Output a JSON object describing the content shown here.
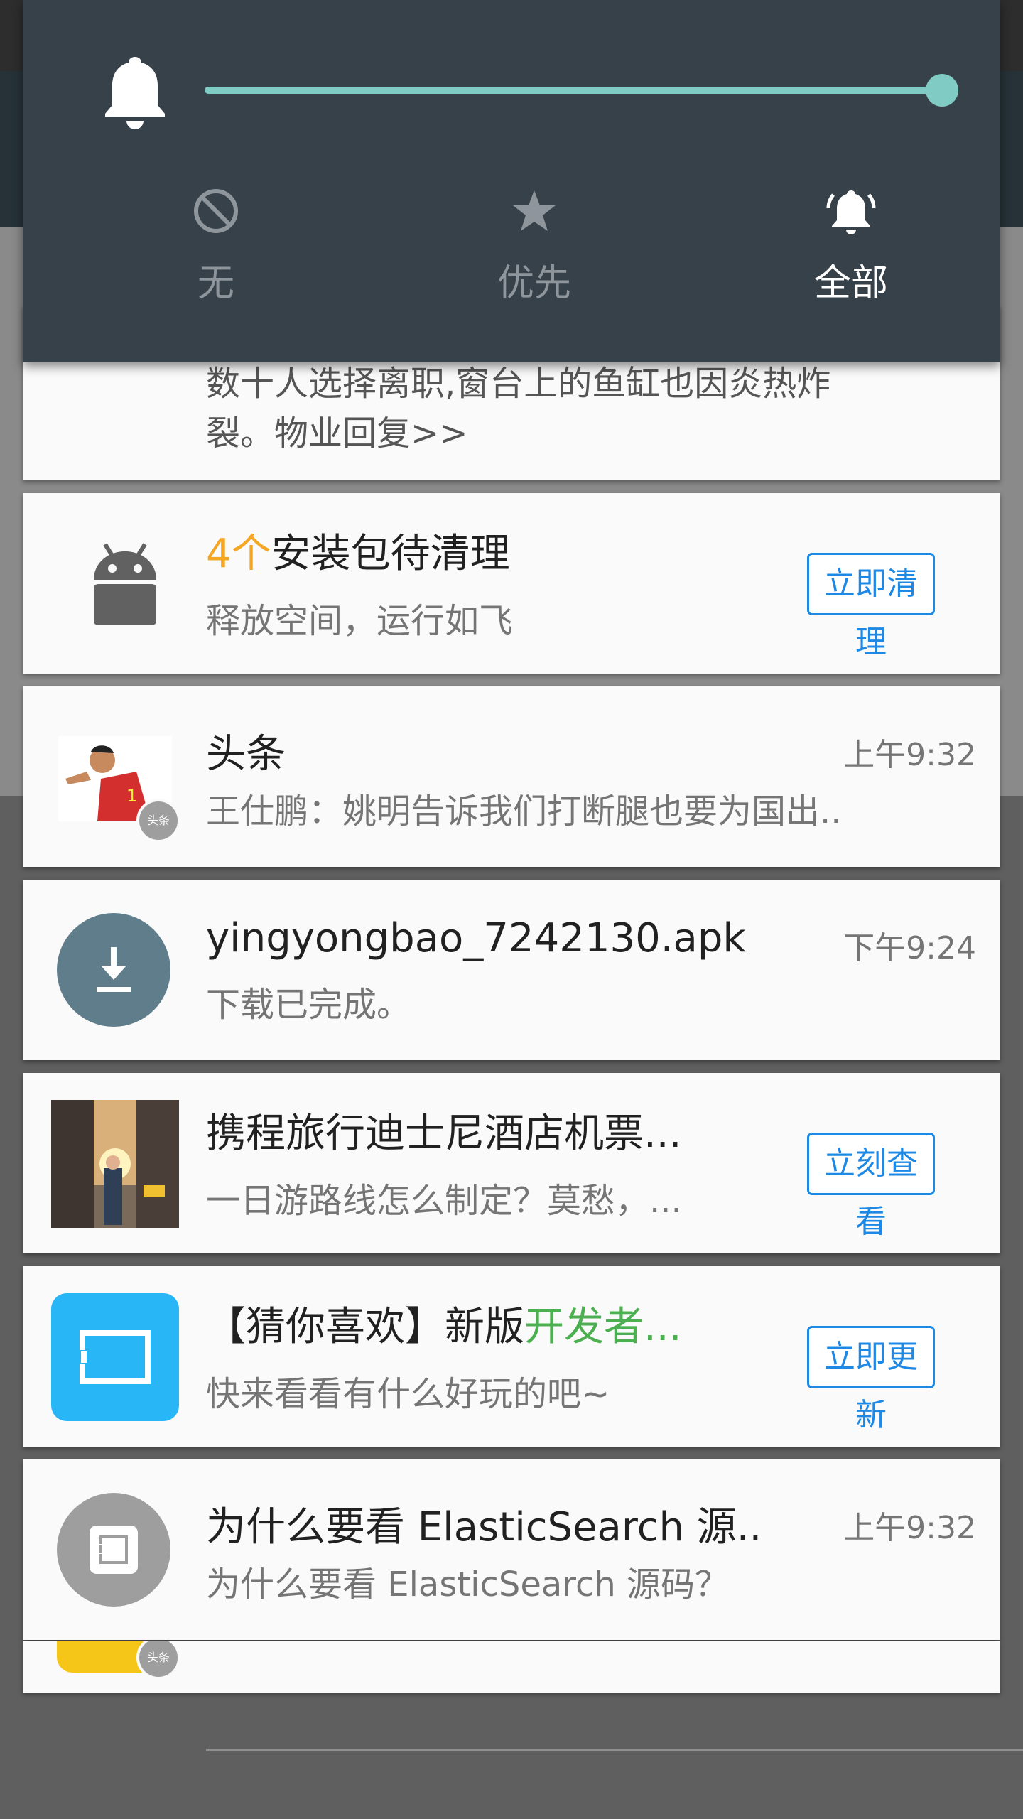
{
  "volume_panel": {
    "level": 1.0,
    "modes": [
      {
        "label": "无",
        "icon": "block-icon",
        "active": false
      },
      {
        "label": "优先",
        "icon": "star-icon",
        "active": false
      },
      {
        "label": "全部",
        "icon": "bell-ring-icon",
        "active": true
      }
    ]
  },
  "notifications": {
    "partial_top": {
      "line1": "数十人选择离职,窗台上的鱼缸也因炎热炸",
      "line2": "裂。物业回复>>"
    },
    "cleanup": {
      "count": "4个",
      "title": "安装包待清理",
      "subtitle": "释放空间，运行如飞",
      "button": "立即清理"
    },
    "toutiao": {
      "title": "头条",
      "time": "上午9:32",
      "text": "王仕鹏：姚明告诉我们打断腿也要为国出..",
      "badge": "头条"
    },
    "download": {
      "title": "yingyongbao_7242130.apk",
      "time": "下午9:24",
      "text": "下载已完成。"
    },
    "ctrip": {
      "title": "携程旅行迪士尼酒店机票...",
      "text": "一日游路线怎么制定？莫愁，...",
      "button": "立刻查看"
    },
    "recommend": {
      "title_prefix": "【猜你喜欢】新版",
      "title_highlight": "开发者...",
      "text": "快来看看有什么好玩的吧~",
      "button": "立即更新"
    },
    "elastic": {
      "title": "为什么要看 ElasticSearch 源..",
      "time": "上午9:32",
      "text": "为什么要看 ElasticSearch 源码？"
    },
    "partial_bottom": {
      "badge": "头条"
    }
  },
  "colors": {
    "accent_teal": "#80cbc4",
    "panel_bg": "#37414a",
    "button_blue": "#1e88e5",
    "count_orange": "#f5a623",
    "highlight_green": "#4caf50",
    "app_blue": "#29b6f6",
    "download_icon_bg": "#607d8b"
  }
}
